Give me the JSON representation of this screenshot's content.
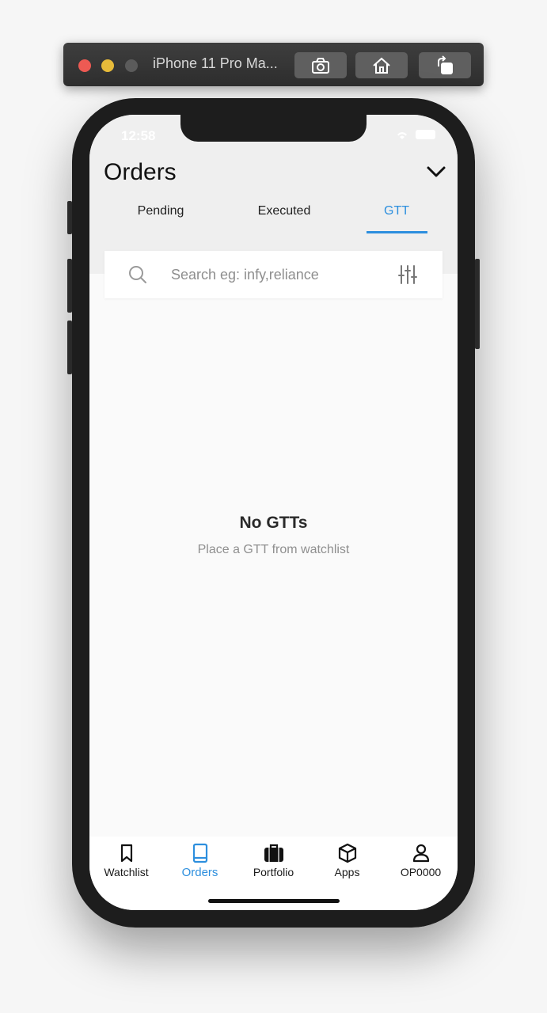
{
  "simulator": {
    "title": "iPhone 11 Pro Ma...",
    "buttons": [
      "screenshot-icon",
      "home-icon",
      "rotate-icon"
    ]
  },
  "status_bar": {
    "time": "12:58"
  },
  "header": {
    "title": "Orders",
    "tabs": [
      {
        "label": "Pending"
      },
      {
        "label": "Executed"
      },
      {
        "label": "GTT",
        "active": true
      }
    ]
  },
  "search": {
    "placeholder": "Search eg: infy,reliance",
    "value": ""
  },
  "empty_state": {
    "title": "No GTTs",
    "subtitle": "Place a GTT from watchlist"
  },
  "bottom_nav": {
    "items": [
      {
        "label": "Watchlist",
        "icon": "bookmark-icon"
      },
      {
        "label": "Orders",
        "icon": "book-icon",
        "active": true
      },
      {
        "label": "Portfolio",
        "icon": "briefcase-icon"
      },
      {
        "label": "Apps",
        "icon": "cube-icon"
      },
      {
        "label": "OP0000",
        "icon": "user-icon"
      }
    ]
  },
  "colors": {
    "accent": "#2d8fde",
    "header_bg": "#efefef",
    "screen_bg": "#fafafa"
  }
}
